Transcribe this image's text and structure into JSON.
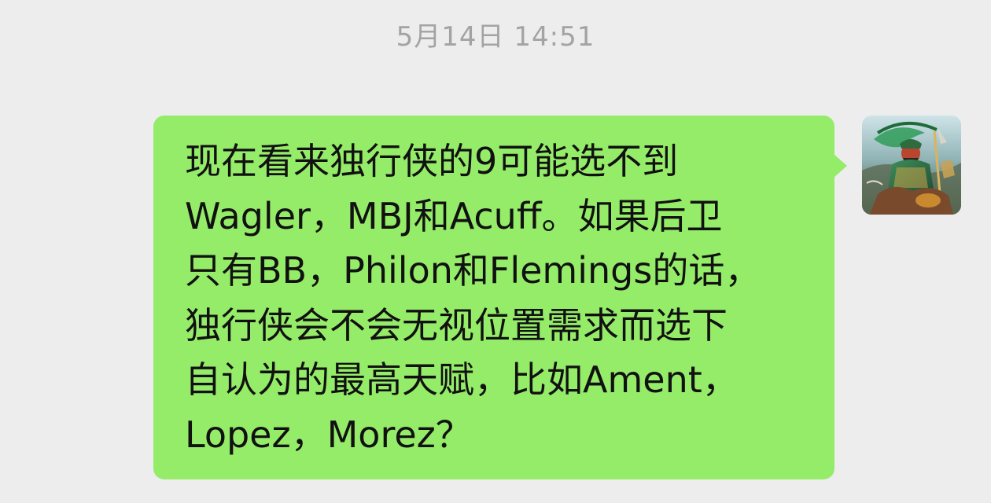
{
  "chat": {
    "timestamp": "5月14日 14:51",
    "message": {
      "lines": [
        "现在看来独行侠的9可能选不到",
        "Wagler，MBJ和Acuff。如果后卫",
        "只有BB，Philon和Flemings的话，",
        "独行侠会不会无视位置需求而选下",
        "自认为的最高天赋，比如Ament，",
        "Lopez，Morez？"
      ],
      "bubble_color": "#95ec69",
      "text_color": "#111111"
    },
    "background_color": "#ededed",
    "timestamp_color": "#a3a3a3",
    "sender_avatar": {
      "icon": "warrior-avatar-icon"
    }
  }
}
